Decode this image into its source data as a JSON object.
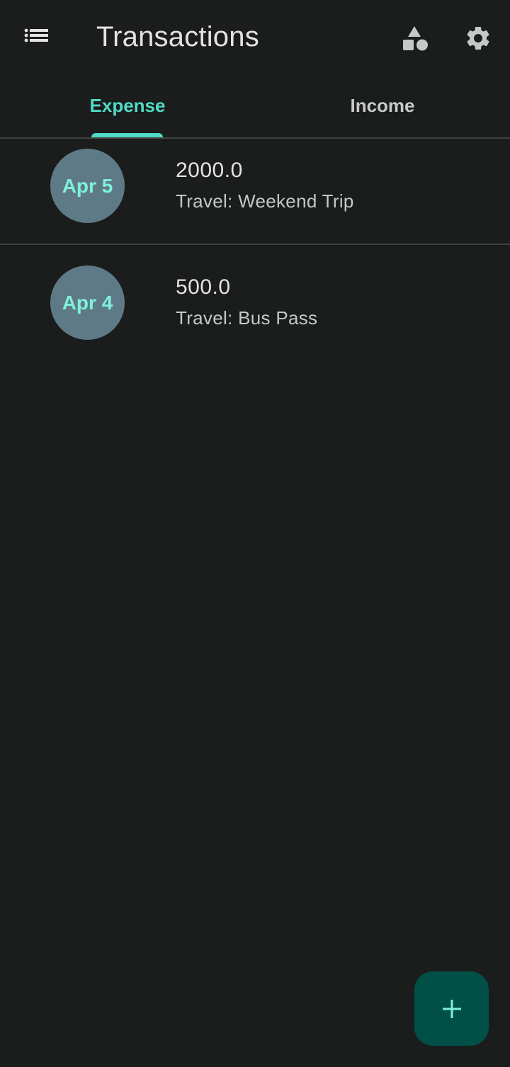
{
  "app_bar": {
    "title": "Transactions",
    "menu_icon": "list-icon",
    "shapes_icon": "category-shapes-icon",
    "settings_icon": "gear-icon"
  },
  "tabs": [
    {
      "label": "Expense",
      "selected": true
    },
    {
      "label": "Income",
      "selected": false
    }
  ],
  "transactions": [
    {
      "date": "Apr 5",
      "amount": "2000.0",
      "description": "Travel: Weekend Trip"
    },
    {
      "date": "Apr 4",
      "amount": "500.0",
      "description": "Travel: Bus Pass"
    }
  ],
  "fab": {
    "icon": "plus-icon"
  },
  "colors": {
    "background": "#1b1c1c",
    "accent": "#4fdbc5",
    "avatar_bg": "#5f7a87",
    "avatar_text": "#7ff0db",
    "fab_bg": "#005048"
  }
}
